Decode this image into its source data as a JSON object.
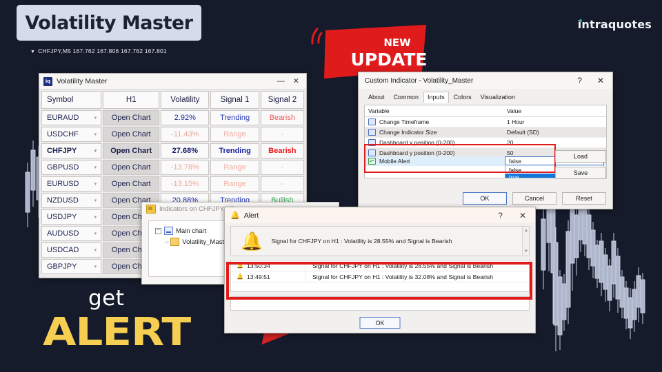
{
  "header": {
    "title": "Volatility Master",
    "brand": "intraquotes",
    "quote_line": "CHFJPY,M5  167.762 167.806 167.762 167.801",
    "caret": "▼"
  },
  "ribbon": {
    "line1": "NEW",
    "line2": "UPDATE"
  },
  "promo": {
    "get": "get",
    "alert": "ALERT"
  },
  "dashboard": {
    "title": "Volatility Master",
    "app_icon_text": "iq",
    "minimize": "—",
    "close": "✕",
    "columns": [
      "Symbol",
      "H1",
      "Volatility",
      "Signal 1",
      "Signal 2"
    ],
    "rows": [
      {
        "symbol": "EURAUD",
        "h1": "Open Chart",
        "volatility": "2.92%",
        "signal1": "Trending",
        "signal2": "Bearish",
        "state": "active"
      },
      {
        "symbol": "USDCHF",
        "h1": "Open Chart",
        "volatility": "-11.43%",
        "signal1": "Range",
        "signal2": "-",
        "state": "dim"
      },
      {
        "symbol": "CHFJPY",
        "h1": "Open Chart",
        "volatility": "27.68%",
        "signal1": "Trending",
        "signal2": "Bearish",
        "state": "strong"
      },
      {
        "symbol": "GBPUSD",
        "h1": "Open Chart",
        "volatility": "-13.78%",
        "signal1": "Range",
        "signal2": "-",
        "state": "dim"
      },
      {
        "symbol": "EURUSD",
        "h1": "Open Chart",
        "volatility": "-13.15%",
        "signal1": "Range",
        "signal2": "-",
        "state": "dim"
      },
      {
        "symbol": "NZDUSD",
        "h1": "Open Chart",
        "volatility": "20.88%",
        "signal1": "Trending",
        "signal2": "Bullish",
        "state": "bull"
      },
      {
        "symbol": "USDJPY",
        "h1": "Open Chart",
        "volatility": "",
        "signal1": "",
        "signal2": "",
        "state": "hidden"
      },
      {
        "symbol": "AUDUSD",
        "h1": "Open Chart",
        "volatility": "",
        "signal1": "",
        "signal2": "",
        "state": "hidden"
      },
      {
        "symbol": "USDCAD",
        "h1": "Open Chart",
        "volatility": "",
        "signal1": "",
        "signal2": "",
        "state": "hidden"
      },
      {
        "symbol": "GBPJPY",
        "h1": "Open Chart",
        "volatility": "",
        "signal1": "",
        "signal2": "",
        "state": "hidden"
      }
    ],
    "chevron": "▾"
  },
  "indicators_window": {
    "title": "Indicators on CHFJPY,M5",
    "tree_expander": "−",
    "root": "Main chart",
    "child": "Volatility_Master"
  },
  "custom_indicator": {
    "title": "Custom Indicator - Volatility_Master",
    "help": "?",
    "close": "✕",
    "tabs": [
      "About",
      "Common",
      "Inputs",
      "Colors",
      "Visualization"
    ],
    "active_tab": "Inputs",
    "table_headers": [
      "Variable",
      "Value"
    ],
    "params": [
      {
        "name": "Change Timeframe",
        "value": "1 Hour"
      },
      {
        "name": "Change Indicator Size",
        "value": "Default (SD)"
      },
      {
        "name": "Dashboard x position (0-200)",
        "value": "20"
      },
      {
        "name": "Dashboard y position (0-200)",
        "value": "50"
      }
    ],
    "highlighted_param": {
      "name": "Mobile Alert",
      "value": "false"
    },
    "dropdown_options": [
      "false",
      "true"
    ],
    "dropdown_selected": "true",
    "dropdown_chevron": "⌄",
    "side_buttons": [
      "Load",
      "Save"
    ],
    "footer_buttons": [
      "OK",
      "Cancel",
      "Reset"
    ],
    "highlight_color": "#e01b1b"
  },
  "alert_dialog": {
    "title": "Alert",
    "help": "?",
    "close": "✕",
    "bell_icon": "🔔",
    "message": "Signal for CHFJPY on H1 : Volatility is 28.55% and Signal is Bearish",
    "scroll_up": "▲",
    "scroll_down": "▼",
    "log_rows": [
      {
        "time": "13:50:34",
        "text": "Signal for CHFJPY on H1 : Volatility is 28.55% and Signal is Bearish"
      },
      {
        "time": "13:49:51",
        "text": "Signal for CHFJPY on H1 : Volatility is 32.08% and Signal is Bearish"
      }
    ],
    "ok_label": "OK",
    "highlight_color": "#e01b1b"
  },
  "colors": {
    "background": "#161b2b",
    "accent_red": "#e01b1b",
    "accent_yellow": "#f6cf52",
    "brand_teal": "#2fb3a0",
    "bullish": "#2fa84f",
    "bearish": "#ef5a5a"
  }
}
